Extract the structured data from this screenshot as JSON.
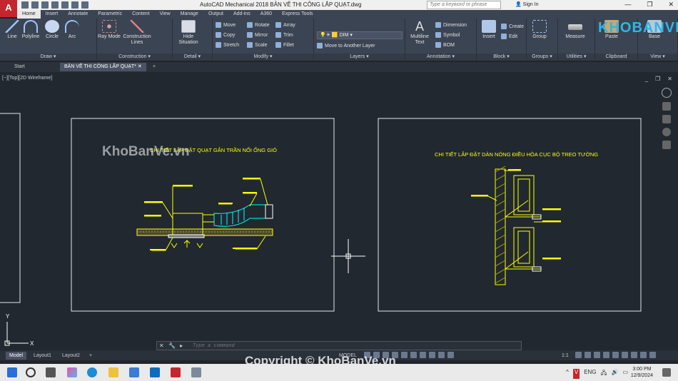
{
  "titlebar": {
    "app_logo": "A",
    "title": "AutoCAD Mechanical 2018    BẢN VẼ THI CÔNG LẮP QUẠT.dwg",
    "search_placeholder": "Type a keyword or phrase",
    "signin": "Sign In",
    "win_minimize": "—",
    "win_restore": "❐",
    "win_close": "✕"
  },
  "menu_tabs": [
    "Home",
    "Insert",
    "Annotate",
    "Parametric",
    "Content",
    "View",
    "Manage",
    "Output",
    "Add-ins",
    "A360",
    "Express Tools"
  ],
  "ribbon": {
    "draw": {
      "label": "Draw",
      "line": "Line",
      "polyline": "Polyline",
      "circle": "Circle",
      "arc": "Arc"
    },
    "construction": {
      "label": "Construction",
      "ray": "Ray Mode",
      "lines": "Construction Lines"
    },
    "detail": {
      "label": "Detail",
      "hide": "Hide Situation"
    },
    "modify": {
      "label": "Modify",
      "move": "Move",
      "rotate": "Rotate",
      "array": "Array",
      "copy": "Copy",
      "mirror": "Mirror",
      "trim": "Trim",
      "stretch": "Stretch",
      "scale": "Scale",
      "fillet": "Fillet"
    },
    "layers": {
      "label": "Layers",
      "current_layer": "DIM",
      "move_layer": "Move to Another Layer"
    },
    "annotation": {
      "label": "Annotation",
      "multiline": "Multiline Text",
      "dimension": "Dimension",
      "symbol": "Symbol",
      "bom": "BOM"
    },
    "block": {
      "label": "Block",
      "insert": "Insert",
      "create": "Create",
      "edit": "Edit"
    },
    "groups": {
      "label": "Groups",
      "group": "Group"
    },
    "utilities": {
      "label": "Utilities",
      "measure": "Measure"
    },
    "clipboard": {
      "label": "Clipboard",
      "paste": "Paste"
    },
    "view": {
      "label": "View",
      "base": "Base"
    }
  },
  "doc_tabs": {
    "start": "Start",
    "drawing": "BẢN VẼ THI CÔNG LẮP QUẠT*",
    "add": "+"
  },
  "viewport": {
    "label": "[−][Top][2D Wireframe]",
    "ctrl_min": "_",
    "ctrl_restore": "❐",
    "ctrl_close": "✕",
    "drawing1_title": "CHI TIẾT LẮP ĐẶT QUẠT GẮN TRẦN NỐI ỐNG GIÓ",
    "drawing2_title": "CHI TIẾT LẮP ĐẶT DÀN NÓNG ĐIỀU HÒA CỤC BỘ TREO TƯỜNG",
    "ucs_y": "Y",
    "ucs_x": "X"
  },
  "command": {
    "placeholder": "Type a command",
    "close": "✕",
    "settings": "🔧"
  },
  "layout_tabs": [
    "Model",
    "Layout1",
    "Layout2"
  ],
  "layout_add": "+",
  "status": {
    "model": "MODEL",
    "scale": "1:1"
  },
  "taskbar": {
    "time": "3:00 PM",
    "date": "12/9/2024",
    "lang": "ENG"
  },
  "watermarks": {
    "top": "KHOBANVE",
    "mid": "KhoBanVe.vn",
    "bottom": "Copyright © KhoBanVe.vn"
  },
  "colors": {
    "accent": "#c4262e",
    "ribbon": "#3b4453",
    "canvas": "#212830",
    "cad_yellow": "#ffff00",
    "cad_cyan": "#00ffff"
  }
}
